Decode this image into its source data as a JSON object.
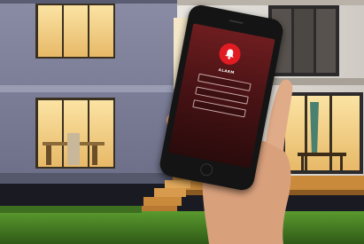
{
  "phone": {
    "status_bar": "",
    "alert_title": "ALARM",
    "alert_message": "",
    "buttons": [
      "",
      "",
      ""
    ],
    "alert_color": "#e11b22"
  },
  "scene": {
    "house_wall_color": "#7d7f98",
    "window_glow_color": "#f6d58a",
    "lawn_color": "#4f8a2a"
  }
}
